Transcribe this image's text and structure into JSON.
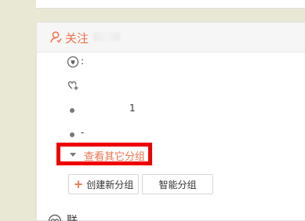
{
  "top_panel": {},
  "follow_section": {
    "icon": "user-follow-icon",
    "title": "关注",
    "accent_color": "#eb7350",
    "groups": [
      {
        "icon": "special-follow-icon",
        "label": ":"
      },
      {
        "icon": "heart-plus-icon",
        "label": ""
      },
      {
        "icon": "bullet-dot",
        "label": "1"
      },
      {
        "icon": "bullet-dot",
        "label": "-"
      }
    ],
    "more_groups_label": "查看其它分组",
    "highlight_color": "#ee0000",
    "create_group_label": "创建新分组",
    "smart_group_label": "智能分组"
  },
  "next_section": {
    "icon": "contacts-icon",
    "title": "联"
  }
}
